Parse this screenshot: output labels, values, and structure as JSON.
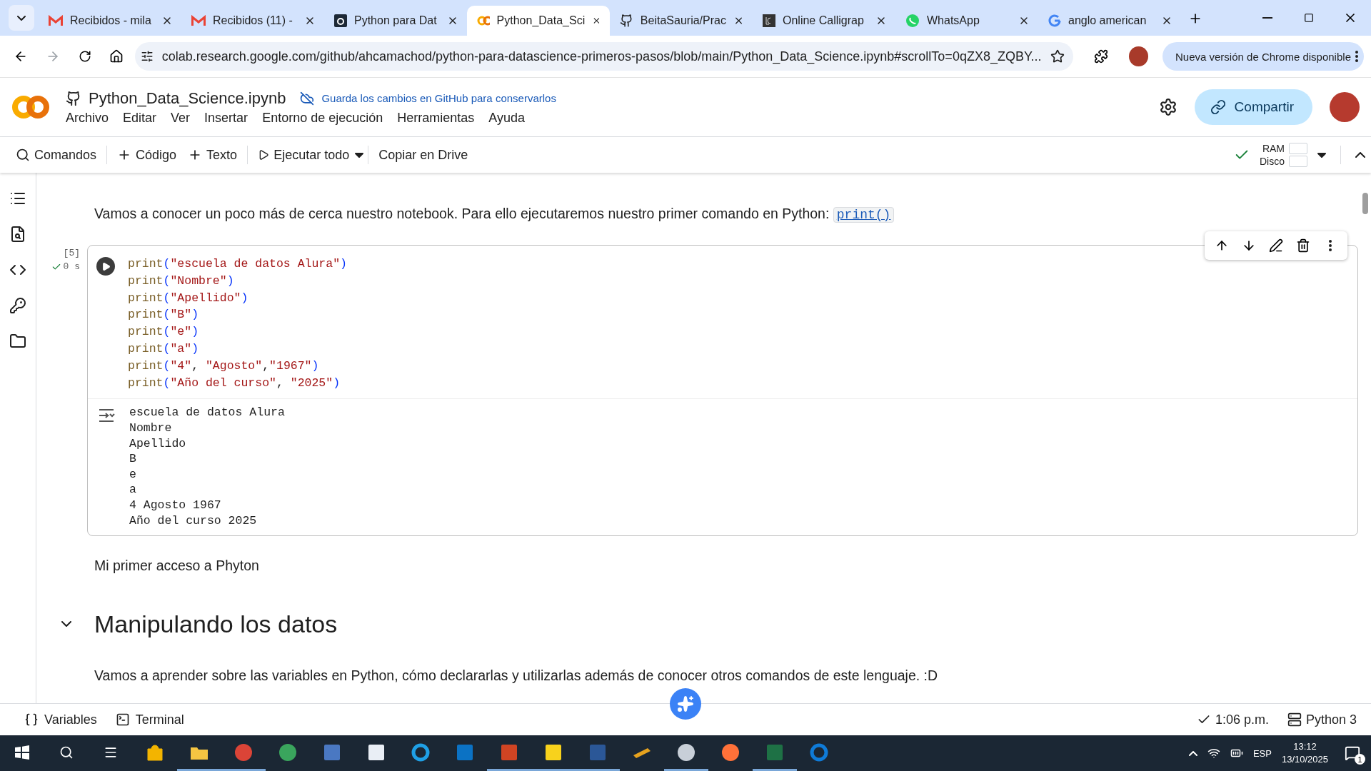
{
  "browser": {
    "tabs": [
      {
        "title": "Recibidos - mila",
        "kind": "gmail",
        "selected": false
      },
      {
        "title": "Recibidos (11) -",
        "kind": "gmail",
        "selected": false
      },
      {
        "title": "Python para Dat",
        "kind": "alura",
        "selected": false
      },
      {
        "title": "Python_Data_Sci",
        "kind": "colab",
        "selected": true
      },
      {
        "title": "BeitaSauria/Prac",
        "kind": "github",
        "selected": false
      },
      {
        "title": "Online Calligrap",
        "kind": "calligraphy",
        "selected": false
      },
      {
        "title": "WhatsApp",
        "kind": "whatsapp",
        "selected": false
      },
      {
        "title": "anglo american",
        "kind": "google",
        "selected": false
      }
    ],
    "address": "colab.research.google.com/github/ahcamachod/python-para-datascience-primeros-pasos/blob/main/Python_Data_Science.ipynb#scrollTo=0qZX8_ZQBY...",
    "update_button": "Nueva versión de Chrome disponible"
  },
  "notebook": {
    "title": "Python_Data_Science.ipynb",
    "save_notice": "Guarda los cambios en GitHub para conservarlos",
    "menu": [
      "Archivo",
      "Editar",
      "Ver",
      "Insertar",
      "Entorno de ejecución",
      "Herramientas",
      "Ayuda"
    ],
    "share_button": "Compartir"
  },
  "toolbar": {
    "items": [
      {
        "label": "Comandos",
        "kind": "search"
      },
      {
        "label": "Código",
        "kind": "add"
      },
      {
        "label": "Texto",
        "kind": "add"
      },
      {
        "label": "Ejecutar todo",
        "kind": "run"
      },
      {
        "label": "Copiar en Drive",
        "kind": "plain"
      }
    ],
    "connected": true,
    "ram_label": "RAM",
    "disk_label": "Disco"
  },
  "content": [
    {
      "kind": "paragraph",
      "text": "Vamos a conocer un poco más de cerca nuestro notebook. Para ello ejecutaremos nuestro primer comando en Python: ",
      "code": "print()"
    },
    {
      "kind": "code_cell",
      "exec_count": "[5]",
      "duration": "0 s",
      "lines": [
        "print(\"escuela de datos Alura\")",
        "print(\"Nombre\")",
        "print(\"Apellido\")",
        "print(\"B\")",
        "print(\"e\")",
        "print(\"a\")",
        "print(\"4\", \"Agosto\",\"1967\")",
        "print(\"Año del curso\", \"2025\")"
      ],
      "output": [
        "escuela de datos Alura",
        "Nombre",
        "Apellido",
        "B",
        "e",
        "a",
        "4 Agosto 1967",
        "Año del curso 2025"
      ]
    },
    {
      "kind": "paragraph",
      "text": "Mi primer acceso a Phyton"
    },
    {
      "kind": "heading",
      "text": "Manipulando los datos",
      "expanded": true
    },
    {
      "kind": "paragraph",
      "text": "Vamos a aprender sobre las variables en Python, cómo declararlas y utilizarlas además de conocer otros comandos de este lenguaje. :D"
    }
  ],
  "status_bar": {
    "items": [
      {
        "label": "Variables",
        "kind": "variables"
      },
      {
        "label": "Terminal",
        "kind": "terminal"
      }
    ],
    "time": "1:06 p.m.",
    "runtime": "Python 3"
  },
  "taskbar": {
    "apps": [
      {
        "kind": "store",
        "running": false
      },
      {
        "kind": "explorer",
        "running": true
      },
      {
        "kind": "chrome",
        "running": true
      },
      {
        "kind": "globe",
        "running": false
      },
      {
        "kind": "calculator",
        "running": false
      },
      {
        "kind": "bird",
        "running": false
      },
      {
        "kind": "ie",
        "running": false
      },
      {
        "kind": "remote",
        "running": false
      },
      {
        "kind": "powerpoint",
        "running": true
      },
      {
        "kind": "sticky",
        "running": true
      },
      {
        "kind": "word",
        "running": true
      },
      {
        "kind": "ruler",
        "running": false
      },
      {
        "kind": "paint",
        "running": true
      },
      {
        "kind": "firefox",
        "running": false
      },
      {
        "kind": "excel",
        "running": true
      },
      {
        "kind": "edge",
        "running": false
      }
    ],
    "language": "ESP",
    "time": "13:12",
    "date": "13/10/2025",
    "notifications": "1"
  }
}
